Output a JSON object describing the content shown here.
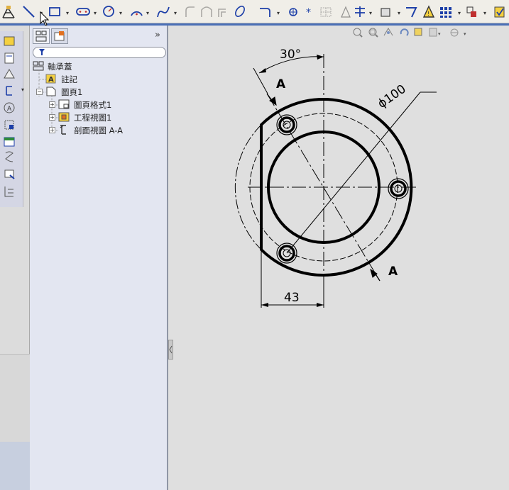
{
  "toolbar": {
    "sketch_tools": [
      "smart-dimension",
      "line",
      "rectangle",
      "slot",
      "circle",
      "arc",
      "spline",
      "fillet",
      "chamfer",
      "offset",
      "trim",
      "point",
      "centerline",
      "mirror",
      "pattern",
      "relations",
      "display"
    ]
  },
  "view_toolbar": {
    "tools": [
      "zoom-to-fit",
      "zoom-area",
      "previous-view",
      "rotate",
      "pan",
      "display-style",
      "view-orientation"
    ]
  },
  "feature_tree": {
    "tabs": [
      "feature-manager",
      "property-manager"
    ],
    "collapse": "»",
    "root": "軸承蓋",
    "items": [
      {
        "label": "註記"
      },
      {
        "label": "圖頁1"
      },
      {
        "label": "圖頁格式1"
      },
      {
        "label": "工程視圖1"
      },
      {
        "label": "剖面視圖 A-A"
      }
    ]
  },
  "drawing": {
    "angle_dim": "30°",
    "diameter_dim": "ϕ100",
    "width_dim": "43",
    "section_label_top": "A",
    "section_label_bottom": "A"
  },
  "colors": {
    "divider": "#4a6fb6",
    "tree_bg": "#e3e6f1",
    "canvas_bg": "#dfdfdf"
  }
}
